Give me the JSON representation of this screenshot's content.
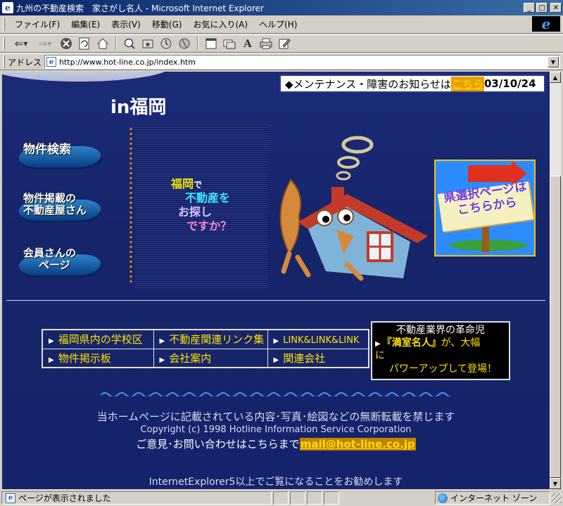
{
  "window": {
    "title": "九州の不動産検索　家さがし名人 - Microsoft Internet Explorer",
    "app_icon": "ie-page-icon"
  },
  "menu": {
    "items": [
      "ファイル(F)",
      "編集(E)",
      "表示(V)",
      "移動(G)",
      "お気に入り(A)",
      "ヘルプ(H)"
    ]
  },
  "toolbar": {
    "icons": [
      "back-icon",
      "forward-icon",
      "stop-icon",
      "refresh-icon",
      "home-icon",
      "search-icon",
      "favorites-icon",
      "history-icon",
      "channels-icon",
      "fullscreen-icon",
      "mail-icon",
      "font-icon",
      "print-icon",
      "edit-icon"
    ]
  },
  "address": {
    "label": "アドレス",
    "url": "http://www.hot-line.co.jp/index.htm"
  },
  "page": {
    "notice": {
      "prefix": "◆メンテナンス・障害のお知らせは",
      "link": "こちら",
      "date": "03/10/24"
    },
    "heading": "in福岡",
    "side_buttons": {
      "search": "物件検索",
      "agents_line1": "物件掲載の",
      "agents_line2": "不動産屋さん",
      "members_line1": "会員さんの",
      "members_line2": "ページ"
    },
    "tagline": {
      "l1_main": "福岡",
      "l1_small": "で",
      "l2": "不動産を",
      "l3": "お探し",
      "l4": "ですか？"
    },
    "pref_select": {
      "line1": "県選択ページは",
      "line2": "こちらから"
    },
    "links": {
      "school": "福岡県内の学校区",
      "realestate_links": "不動産関連リンク集",
      "linklink": "LINK&LINK&LINK",
      "board": "物件掲示板",
      "company": "会社案内",
      "related": "関連会社"
    },
    "promo": {
      "line1": "不動産業界の革命児",
      "name": "『満室名人』",
      "mid": "が、大幅",
      "line3": "に",
      "line4": "パワーアップして登場！"
    },
    "footer": {
      "copyright_notice": "当ホームページに記載されている内容･写真･絵図などの無断転載を禁じます",
      "copyright": "Copyright (c) 1998 Hotline Information Service Corporation",
      "contact_prefix": "ご意見･お問い合わせはこちらまで",
      "email": "mail@hot-line.co.jp",
      "recommend": "InternetExplorer5以上でご覧になることをお勧めします"
    }
  },
  "status": {
    "text": "ページが表示されました",
    "zone": "インターネット ゾーン"
  },
  "colors": {
    "page_bg": "#1b2b76",
    "link_yellow": "#ffe000",
    "titlebar": "#0a246a"
  }
}
